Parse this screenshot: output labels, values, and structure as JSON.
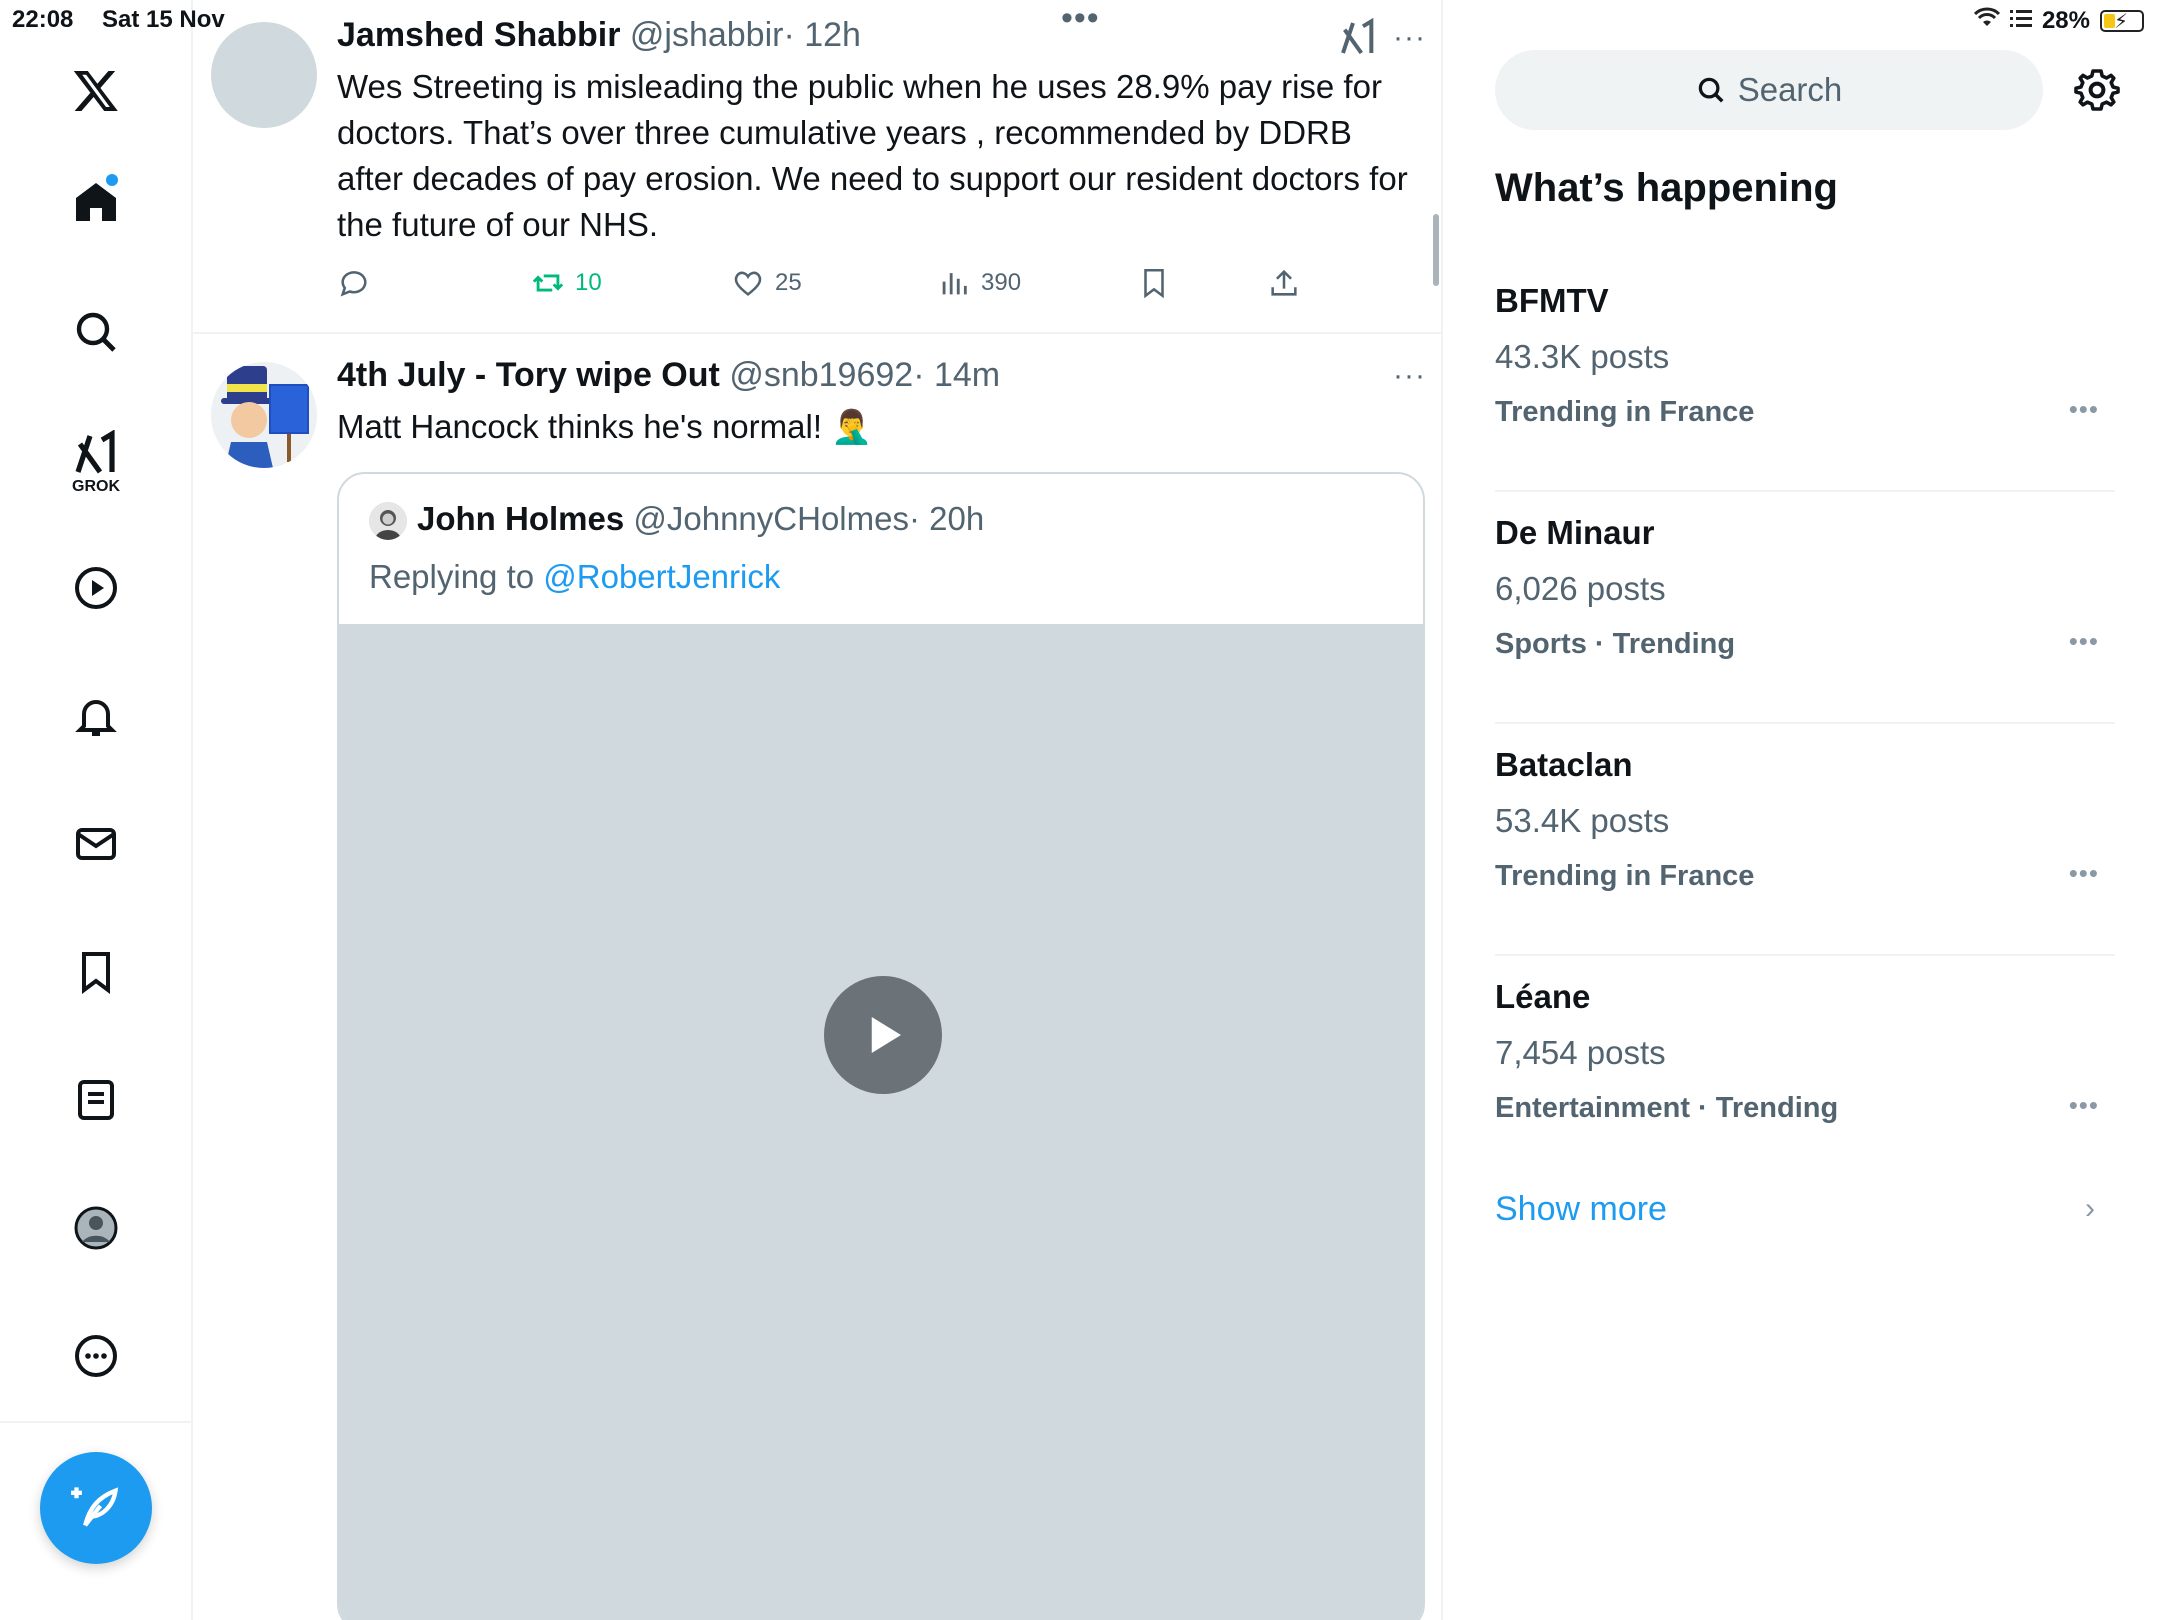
{
  "status_bar": {
    "time": "22:08",
    "date": "Sat 15 Nov",
    "battery": "28%"
  },
  "nav": {
    "grok_label": "GROK"
  },
  "tweet1": {
    "name": "Jamshed Shabbir",
    "handle": "@jshabbir",
    "time": "· 12h",
    "text": "Wes Streeting is misleading the public when he uses 28.9% pay rise for doctors. That’s over three cumulative years , recommended by DDRB after decades of pay erosion. We need to support our resident doctors for the future of our NHS.",
    "retweets": "10",
    "likes": "25",
    "views": "390"
  },
  "tweet2": {
    "name": "4th July - Tory wipe Out",
    "handle": "@snb19692",
    "time": "· 14m",
    "text": "Matt Hancock thinks he's normal! 🤦‍♂️",
    "quote": {
      "name": "John Holmes",
      "handle": "@JohnnyCHolmes",
      "time": "· 20h",
      "replying_prefix": "Replying to ",
      "replying_to": "@RobertJenrick"
    }
  },
  "right": {
    "search_placeholder": "Search",
    "title": "What’s happening",
    "trends": [
      {
        "name": "BFMTV",
        "count": "43.3K posts",
        "category": "Trending in France"
      },
      {
        "name": "De Minaur",
        "count": "6,026 posts",
        "category": "Sports · Trending"
      },
      {
        "name": "Bataclan",
        "count": "53.4K posts",
        "category": "Trending in France"
      },
      {
        "name": "Léane",
        "count": "7,454 posts",
        "category": "Entertainment · Trending"
      }
    ],
    "show_more": "Show more"
  },
  "colors": {
    "accent": "#1d9bf0",
    "retweet": "#00ba7c",
    "secondary_text": "#536471"
  }
}
